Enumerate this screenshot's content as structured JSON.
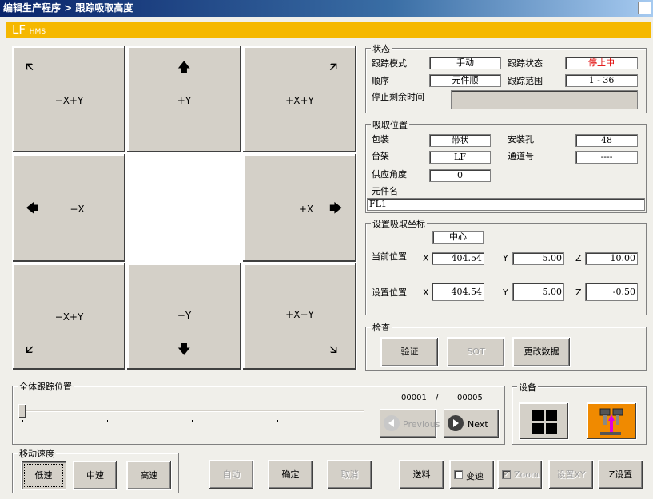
{
  "window": {
    "title": "编辑生产程序 > 跟踪吸取高度"
  },
  "header": {
    "machine": "LF",
    "machine_suffix": "HMS"
  },
  "jog": {
    "nw": "−X+Y",
    "n": "+Y",
    "ne": "+X+Y",
    "w": "−X",
    "e": "+X",
    "sw": "−X+Y",
    "s": "−Y",
    "se": "+X−Y",
    "arrows": {
      "nw": "🡬",
      "n": "🡅",
      "ne": "🡭",
      "w": "🡄",
      "e": "🡆",
      "sw": "🡯",
      "s": "🡇",
      "se": "🡮"
    }
  },
  "status": {
    "title": "状态",
    "track_mode_label": "跟踪模式",
    "track_mode": "手动",
    "track_state_label": "跟踪状态",
    "track_state": "停止中",
    "order_label": "顺序",
    "order": "元件顺",
    "track_range_label": "跟踪范围",
    "track_range": "1 - 36",
    "stop_remaining_label": "停止剩余时间",
    "stop_remaining": ""
  },
  "pickup": {
    "title": "吸取位置",
    "package_label": "包装",
    "package": "带状",
    "mount_hole_label": "安装孔",
    "mount_hole": "48",
    "rack_label": "台架",
    "rack": "LF",
    "lane_label": "通道号",
    "lane": "----",
    "feed_angle_label": "供应角度",
    "feed_angle": "0",
    "part_name_label": "元件名",
    "part_name": "FL1"
  },
  "coords": {
    "title": "设置吸取坐标",
    "mode": "中心",
    "current_label": "当前位置",
    "set_label": "设置位置",
    "x_label": "X",
    "y_label": "Y",
    "z_label": "Z",
    "current": {
      "x": "404.54",
      "y": "5.00",
      "z": "10.00"
    },
    "set": {
      "x": "404.54",
      "y": "5.00",
      "z": "-0.50"
    }
  },
  "check": {
    "title": "检查",
    "verify": "验证",
    "sot": "SOT",
    "change_data": "更改数据"
  },
  "track_position": {
    "title": "全体跟踪位置",
    "current": "00001",
    "sep": "/",
    "total": "00005",
    "previous": "Previous",
    "next": "Next",
    "slider_fraction": 0.0
  },
  "device": {
    "title": "设备"
  },
  "speed": {
    "title": "移动速度",
    "low": "低速",
    "mid": "中速",
    "high": "高速"
  },
  "bottom": {
    "auto": "自动",
    "confirm": "确定",
    "cancel": "取消",
    "feed": "送料",
    "shift_speed": "变速",
    "zoom": "Zoom",
    "set_xy": "设置XY",
    "set_z": "Z设置"
  },
  "colors": {
    "accent": "#f5b800",
    "title_bar": "#0a246a",
    "device_button": "#f08a00",
    "warning_text": "#e00000"
  }
}
